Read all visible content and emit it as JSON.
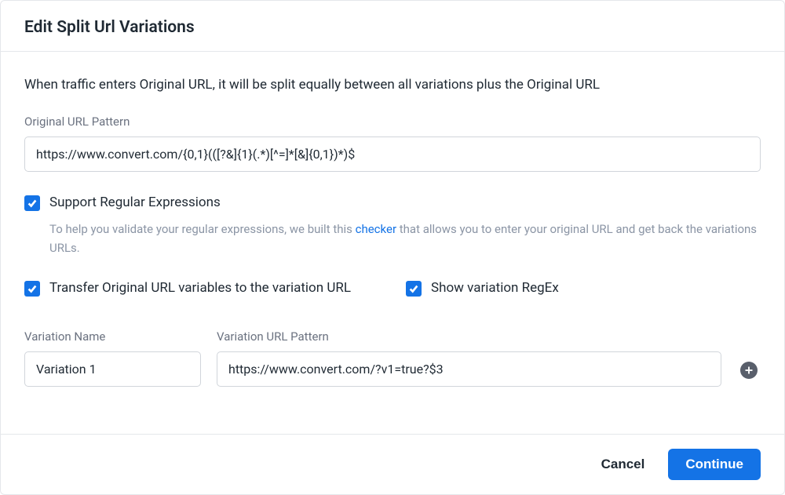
{
  "header": {
    "title": "Edit Split Url Variations"
  },
  "description": "When traffic enters Original URL, it will be split equally between all variations plus the Original URL",
  "original_url": {
    "label": "Original URL Pattern",
    "value": "https://www.convert.com/{0,1}(([?&]{1}(.*)[^=]*[&]{0,1})*)$"
  },
  "regex_checkbox": {
    "label": "Support Regular Expressions",
    "checked": true,
    "helper_prefix": "To help you validate your regular expressions, we built this ",
    "helper_link": "checker",
    "helper_suffix": " that allows you to enter your original URL and get back the variations URLs."
  },
  "transfer_checkbox": {
    "label": "Transfer Original URL variables to the variation URL",
    "checked": true
  },
  "show_regex_checkbox": {
    "label": "Show variation RegEx",
    "checked": true
  },
  "variation": {
    "name_label": "Variation Name",
    "url_label": "Variation URL Pattern",
    "name_value": "Variation 1",
    "url_value": "https://www.convert.com/?v1=true?$3"
  },
  "footer": {
    "cancel": "Cancel",
    "continue": "Continue"
  }
}
